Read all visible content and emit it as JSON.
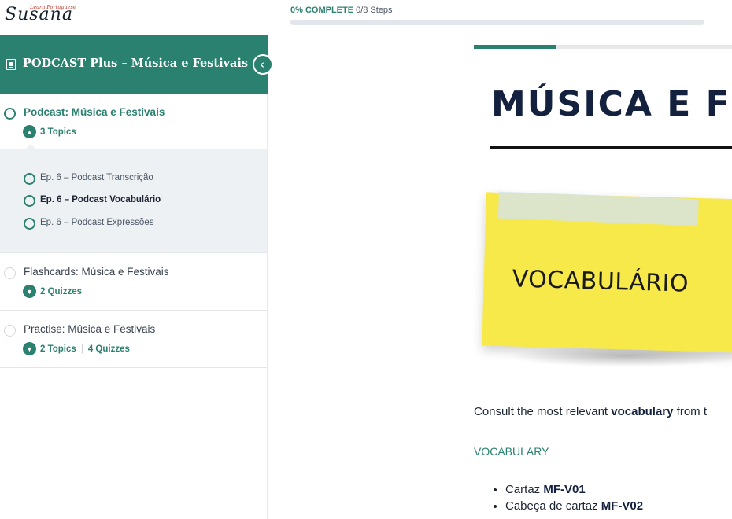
{
  "header": {
    "logo_script": "Susana",
    "logo_tagline": "Learn Portuguese",
    "progress_percent_label": "0% COMPLETE",
    "progress_steps_label": "0/8 Steps",
    "progress_fraction": 0.0
  },
  "sidebar": {
    "course_title": "PODCAST Plus – Música e Festivais",
    "collapse_icon": "chevron-left-icon",
    "lessons": [
      {
        "title": "Podcast: Música e Festivais",
        "toggle_icon": "chevron-up-icon",
        "meta": "3 Topics",
        "topics": [
          {
            "label": "Ep. 6 – Podcast Transcrição"
          },
          {
            "label": "Ep. 6 – Podcast Vocabulário"
          },
          {
            "label": "Ep. 6 – Podcast Expressões"
          }
        ]
      },
      {
        "title": "Flashcards: Música e Festivais",
        "toggle_icon": "chevron-down-icon",
        "meta": "2 Quizzes"
      },
      {
        "title": "Practise: Música e Festivais",
        "toggle_icon": "chevron-down-icon",
        "meta": "2 Topics",
        "meta2": "4 Quizzes"
      }
    ]
  },
  "main": {
    "content_progress_fraction": 0.31,
    "hero_title": "MÚSICA E FES",
    "sticky_label": "VOCABULÁRIO",
    "intro_prefix": "Consult the most relevant ",
    "intro_bold": "vocabulary",
    "intro_suffix": " from t",
    "vocab_heading": "VOCABULARY",
    "vocab_items": [
      {
        "word": "Cartaz",
        "code": "MF-V01"
      },
      {
        "word": "Cabeça de cartaz",
        "code": "MF-V02"
      }
    ]
  },
  "colors": {
    "accent": "#2b8170",
    "sticky": "#f7e94a",
    "navy": "#13213f"
  }
}
